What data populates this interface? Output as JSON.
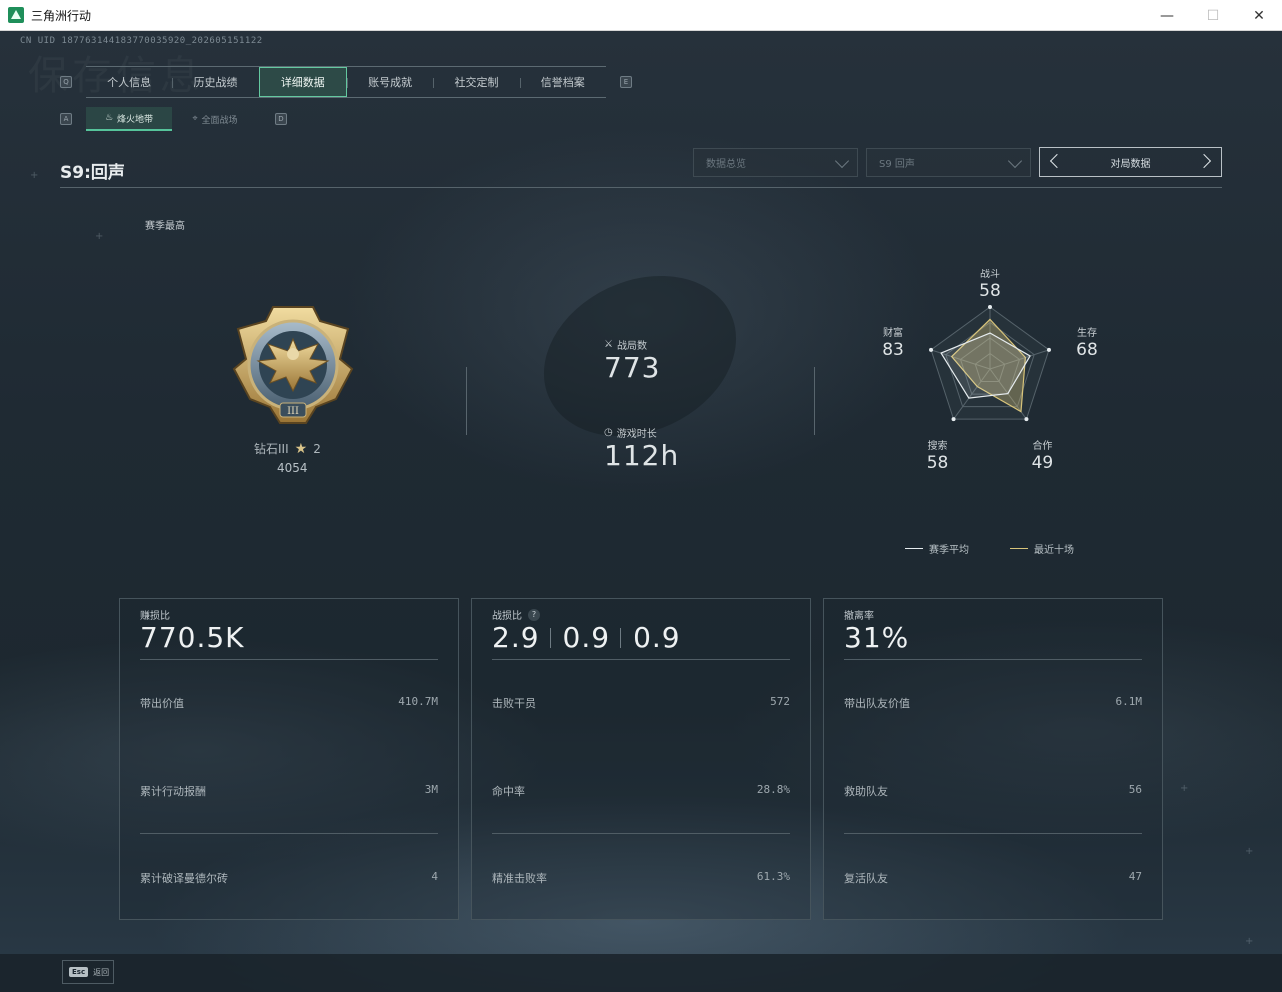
{
  "window": {
    "title": "三角洲行动",
    "controls": [
      "—",
      "☐",
      "✕"
    ]
  },
  "uid": "CN UID 18776314418377003592​0_202605151122",
  "watermark": "保存信息",
  "main_tabs": {
    "left_key": "Q",
    "right_key": "E",
    "items": [
      {
        "label": "个人信息",
        "active": false
      },
      {
        "label": "历史战绩",
        "active": false
      },
      {
        "label": "详细数据",
        "active": true
      },
      {
        "label": "账号成就",
        "active": false
      },
      {
        "label": "社交定制",
        "active": false
      },
      {
        "label": "信誉档案",
        "active": false
      }
    ]
  },
  "sub_tabs": {
    "left_key": "A",
    "right_key": "D",
    "items": [
      {
        "label": "烽火地带",
        "icon": "flame-icon",
        "active": true
      },
      {
        "label": "全面战场",
        "icon": "crosshair-icon",
        "active": false
      }
    ]
  },
  "season_title": "S9:回声",
  "filters": {
    "data_type": "数据总览",
    "season": "S9 回声",
    "match_data": "对局数据"
  },
  "season_best_label": "赛季最高",
  "rank": {
    "name": "钻石III",
    "stars": "2",
    "score": "4054"
  },
  "stats": {
    "matches_label": "战局数",
    "matches_value": "773",
    "playtime_label": "游戏时长",
    "playtime_value": "112h"
  },
  "radar": {
    "axes": [
      {
        "label": "战斗",
        "value": "58"
      },
      {
        "label": "生存",
        "value": "68"
      },
      {
        "label": "合作",
        "value": "49"
      },
      {
        "label": "搜索",
        "value": "58"
      },
      {
        "label": "财富",
        "value": "83"
      }
    ],
    "season_avg": [
      58,
      68,
      49,
      58,
      83
    ],
    "recent_ten": [
      80,
      60,
      85,
      35,
      65
    ],
    "legend": {
      "season_avg": "赛季平均",
      "recent_ten": "最近十场"
    },
    "colors": {
      "season_avg": "#e6ecef",
      "recent_ten": "#d8c47a"
    }
  },
  "cards": [
    {
      "label": "赚损比",
      "big": "770.5K",
      "rows": [
        {
          "k": "带出价值",
          "v": "410.7M"
        },
        {
          "k": "累计行动报酬",
          "v": "3M"
        },
        {
          "k": "累计破译曼德尔砖",
          "v": "4"
        }
      ]
    },
    {
      "label": "战损比",
      "help": "?",
      "big_parts": [
        "2.9",
        "0.9",
        "0.9"
      ],
      "rows": [
        {
          "k": "击败干员",
          "v": "572"
        },
        {
          "k": "命中率",
          "v": "28.8%"
        },
        {
          "k": "精准击败率",
          "v": "61.3%"
        }
      ]
    },
    {
      "label": "撤离率",
      "big": "31%",
      "rows": [
        {
          "k": "带出队友价值",
          "v": "6.1M"
        },
        {
          "k": "救助队友",
          "v": "56"
        },
        {
          "k": "复活队友",
          "v": "47"
        }
      ]
    }
  ],
  "footer": {
    "esc_key": "Esc",
    "esc_label": "返回"
  }
}
